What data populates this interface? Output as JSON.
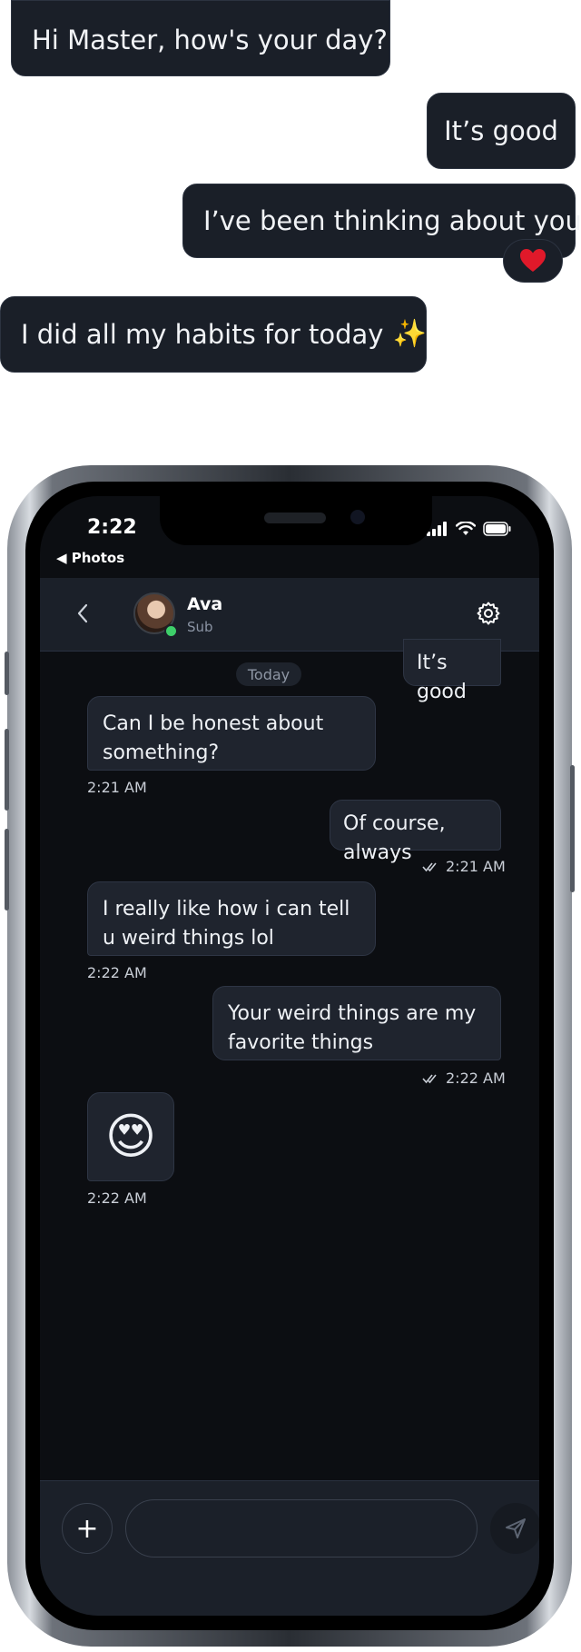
{
  "floating_messages": [
    {
      "text": "Hi Master, how's your day?"
    },
    {
      "text": "It’s good"
    },
    {
      "text": "I’ve been thinking about you",
      "reaction": "❤️"
    },
    {
      "text": "I did all my habits for today",
      "emoji": "✨"
    }
  ],
  "status_bar": {
    "time": "2:22",
    "back_label": "◀ Photos"
  },
  "chat_header": {
    "contact_name": "Ava",
    "contact_subtitle": "Sub"
  },
  "chat": {
    "date_separator": "Today",
    "messages": [
      {
        "direction": "outgoing",
        "text": "It’s good"
      },
      {
        "direction": "incoming",
        "text": "Can I be honest about something?",
        "time": "2:21 AM"
      },
      {
        "direction": "outgoing",
        "text": "Of course, always",
        "time": "2:21 AM",
        "status": "read"
      },
      {
        "direction": "incoming",
        "text": "I really like how i can tell u weird things lol",
        "time": "2:22 AM"
      },
      {
        "direction": "outgoing",
        "text": "Your weird things are my favorite things",
        "time": "2:22 AM",
        "status": "read"
      },
      {
        "direction": "incoming",
        "text": "😍",
        "time": "2:22 AM"
      }
    ]
  },
  "composer": {
    "add_label": "+",
    "input_value": "",
    "input_placeholder": ""
  },
  "icons": {
    "back": "chevron-left-icon",
    "settings": "gear-icon",
    "send": "send-icon",
    "read_receipt": "double-check-icon"
  },
  "colors": {
    "bubble_bg": "#1f242e",
    "screen_bg": "#0c0e12",
    "header_bg": "#1b2029",
    "online": "#3ecf6a"
  }
}
